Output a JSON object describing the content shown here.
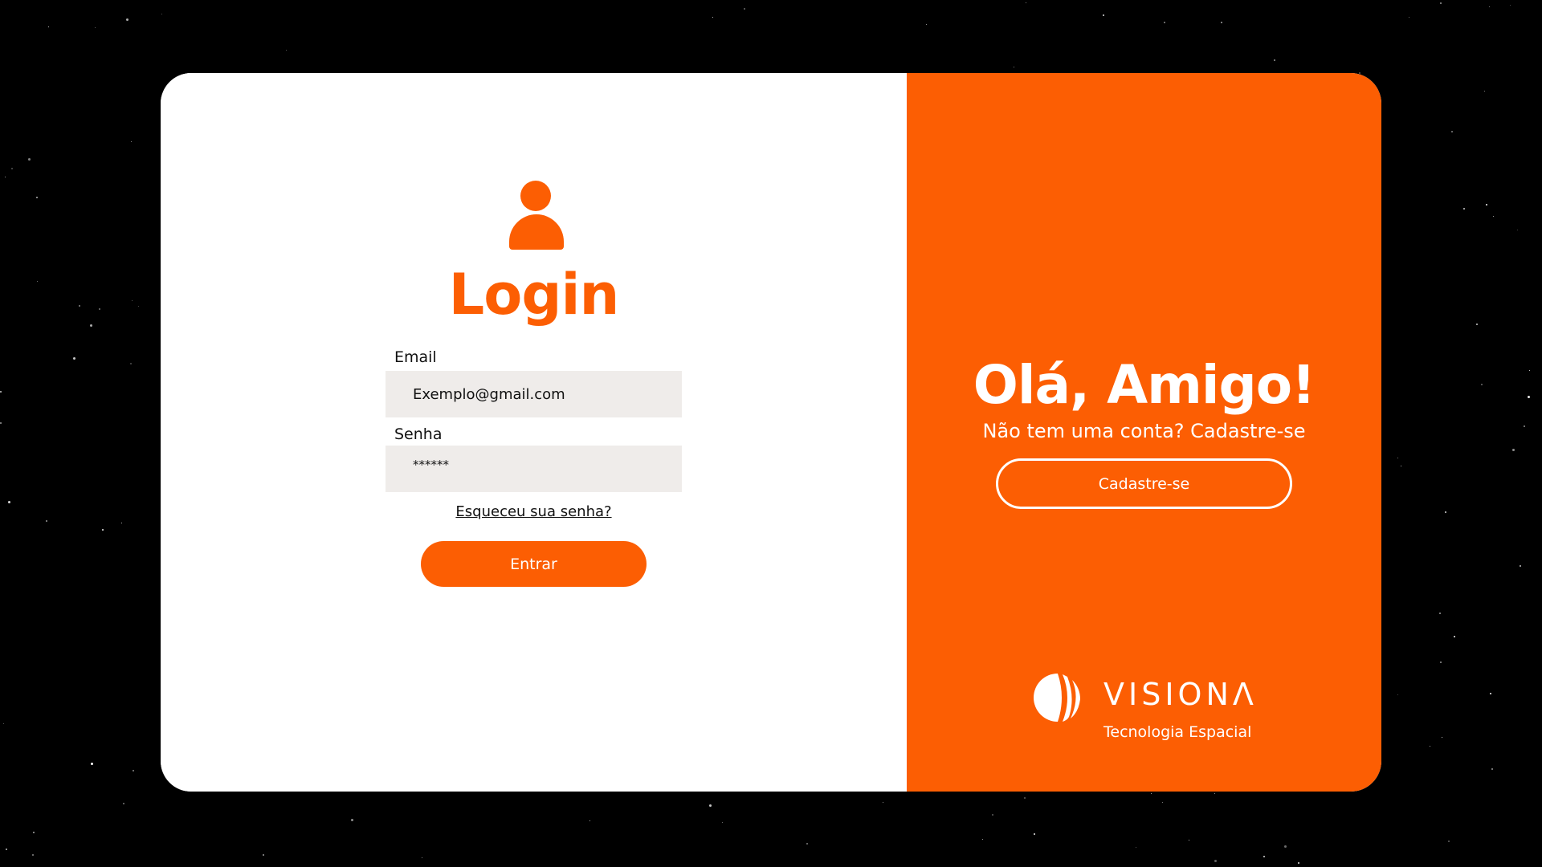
{
  "colors": {
    "accent": "#fc5e03",
    "input_bg": "#efecea",
    "background": "#000000"
  },
  "login": {
    "icon": "user-icon",
    "title": "Login",
    "email_label": "Email",
    "email_value": "Exemplo@gmail.com",
    "password_label": "Senha",
    "password_value": "******",
    "forgot_link": "Esqueceu sua senha?",
    "submit_label": "Entrar"
  },
  "signup": {
    "title": "Olá, Amigo!",
    "subtitle": "Não tem uma conta? Cadastre-se",
    "button_label": "Cadastre-se"
  },
  "logo": {
    "name": "VISIONΛ",
    "tagline": "Tecnologia Espacial"
  }
}
